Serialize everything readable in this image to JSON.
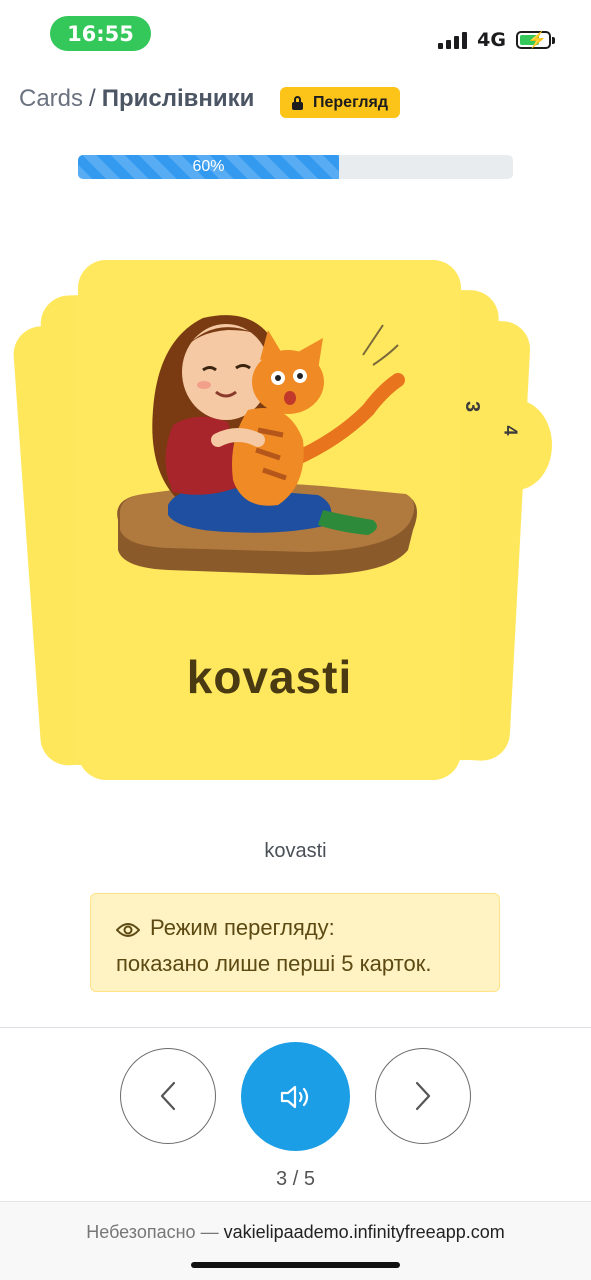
{
  "status_bar": {
    "time": "16:55",
    "network": "4G",
    "battery_level": 0.7
  },
  "breadcrumb": {
    "root": "Cards",
    "separator": "/",
    "current": "Прислівники"
  },
  "mode_badge": {
    "label": "Перегляд",
    "icon": "lock-icon"
  },
  "progress": {
    "value": 60,
    "label": "60%"
  },
  "card": {
    "word": "kovasti",
    "image": "girl hugging orange tabby cat",
    "next_tab_numbers": [
      "3",
      "4"
    ]
  },
  "caption": "kovasti",
  "notice": {
    "icon": "eye-icon",
    "line1": "Режим перегляду:",
    "line2": "показано лише перші 5 карток."
  },
  "controls": {
    "prev_icon": "chevron-left-icon",
    "sound_icon": "speaker-icon",
    "next_icon": "chevron-right-icon"
  },
  "counter": "3 / 5",
  "url_bar": {
    "security_label": "Небезопасно — ",
    "domain": "vakielipaademo.infinityfreeapp.com"
  },
  "colors": {
    "accent_blue": "#1c9ee6",
    "card_yellow": "#ffe85e",
    "badge_yellow": "#fcc419",
    "status_green": "#34c759"
  }
}
